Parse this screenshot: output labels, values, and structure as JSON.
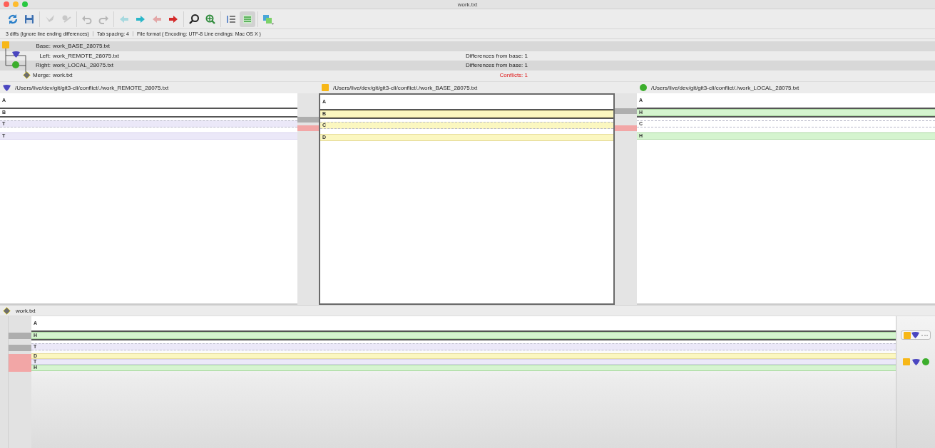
{
  "window": {
    "title": "work.txt"
  },
  "toolbar": {
    "groups": [
      {
        "buttons": [
          {
            "kind": "refresh",
            "disabled": false,
            "selected": false
          },
          {
            "kind": "save",
            "disabled": false,
            "selected": false
          }
        ]
      },
      {
        "buttons": [
          {
            "kind": "merge-left",
            "disabled": true,
            "selected": false
          },
          {
            "kind": "merge-right",
            "disabled": true,
            "selected": false
          }
        ]
      },
      {
        "buttons": [
          {
            "kind": "undo",
            "disabled": true,
            "selected": false
          },
          {
            "kind": "redo",
            "disabled": true,
            "selected": false
          }
        ]
      },
      {
        "buttons": [
          {
            "kind": "prev-diff",
            "disabled": true,
            "selected": false
          },
          {
            "kind": "next-diff",
            "disabled": false,
            "selected": false
          },
          {
            "kind": "prev-conflict",
            "disabled": true,
            "selected": false
          },
          {
            "kind": "next-conflict",
            "disabled": false,
            "selected": false
          }
        ]
      },
      {
        "buttons": [
          {
            "kind": "find",
            "disabled": false,
            "selected": false
          },
          {
            "kind": "find-diff",
            "disabled": false,
            "selected": false
          }
        ]
      },
      {
        "buttons": [
          {
            "kind": "line-numbers",
            "disabled": false,
            "selected": false
          },
          {
            "kind": "show-diffs",
            "disabled": false,
            "selected": true
          }
        ]
      },
      {
        "buttons": [
          {
            "kind": "compare-menu",
            "disabled": false,
            "selected": false
          }
        ]
      }
    ]
  },
  "status_bar": [
    "3 diffs (Ignore line ending differences)",
    "Tab spacing: 4",
    "File format ( Encoding: UTF-8  Line endings: Mac OS X )"
  ],
  "merge_info": [
    {
      "kind": "base",
      "label": "Base:",
      "file": "work_BASE_28075.txt"
    },
    {
      "kind": "remote",
      "label": "Left:",
      "file": "work_REMOTE_28075.txt",
      "summary": "Differences from base: 1",
      "alert": false
    },
    {
      "kind": "local",
      "label": "Right:",
      "file": "work_LOCAL_28075.txt",
      "summary": "Differences from base: 1",
      "alert": false
    },
    {
      "kind": "merge",
      "label": "Merge:",
      "file": "work.txt",
      "summary": "Conflicts: 1",
      "alert": true
    }
  ],
  "panes": [
    {
      "kind": "remote",
      "path": "/Users/live/dev/git/git3-cli/conflict/./work_REMOTE_28075.txt",
      "selected": false,
      "lines": [
        {
          "text": "A",
          "kind": "plain",
          "selected": false,
          "dashed": false
        },
        {
          "text": "B",
          "kind": "plain",
          "selected": true,
          "dashed": false
        },
        {
          "text": "T",
          "kind": "remote",
          "selected": false,
          "dashed": true
        },
        {
          "text": "T",
          "kind": "remote",
          "selected": false,
          "dashed": false
        }
      ]
    },
    {
      "kind": "base",
      "path": "/Users/live/dev/git/git3-cli/conflict/./work_BASE_28075.txt",
      "selected": true,
      "lines": [
        {
          "text": "A",
          "kind": "plain",
          "selected": false,
          "dashed": false
        },
        {
          "text": "B",
          "kind": "base",
          "selected": true,
          "dashed": false
        },
        {
          "text": "C",
          "kind": "base",
          "selected": false,
          "dashed": true
        },
        {
          "text": "D",
          "kind": "base",
          "selected": false,
          "dashed": false
        }
      ]
    },
    {
      "kind": "local",
      "path": "/Users/live/dev/git/git3-cli/conflict/./work_LOCAL_28075.txt",
      "selected": false,
      "lines": [
        {
          "text": "A",
          "kind": "plain",
          "selected": false,
          "dashed": false
        },
        {
          "text": "H",
          "kind": "local",
          "selected": true,
          "dashed": false
        },
        {
          "text": "C",
          "kind": "plain",
          "selected": false,
          "dashed": true
        },
        {
          "text": "H",
          "kind": "local",
          "selected": false,
          "dashed": false
        }
      ]
    }
  ],
  "connectors": [
    {
      "rows": [
        {
          "kind": "none"
        },
        {
          "kind": "none"
        },
        {
          "kind": "change"
        },
        {
          "kind": "conflict"
        }
      ]
    },
    {
      "rows": [
        {
          "kind": "none"
        },
        {
          "kind": "change"
        },
        {
          "kind": "none"
        },
        {
          "kind": "conflict"
        }
      ]
    }
  ],
  "merge_pane": {
    "file": "work.txt",
    "rows": [
      {
        "kind": "none",
        "lines": [
          {
            "text": "A",
            "kind": "plain",
            "selected": false,
            "dashed": false
          }
        ]
      },
      {
        "kind": "change",
        "choice_button": true,
        "lines": [
          {
            "text": "H",
            "kind": "local",
            "selected": true,
            "dashed": false
          }
        ]
      },
      {
        "kind": "change",
        "lines": [
          {
            "text": "T",
            "kind": "remote",
            "selected": false,
            "dashed": true
          }
        ]
      },
      {
        "kind": "conflict",
        "sources": [
          {
            "kind": "base"
          },
          {
            "kind": "remote"
          },
          {
            "kind": "local"
          }
        ],
        "lines": [
          {
            "text": "D",
            "kind": "base",
            "selected": false,
            "dashed": false
          },
          {
            "text": "T",
            "kind": "remote",
            "selected": false,
            "dashed": false
          },
          {
            "text": "H",
            "kind": "local",
            "selected": false,
            "dashed": false
          }
        ]
      }
    ]
  }
}
